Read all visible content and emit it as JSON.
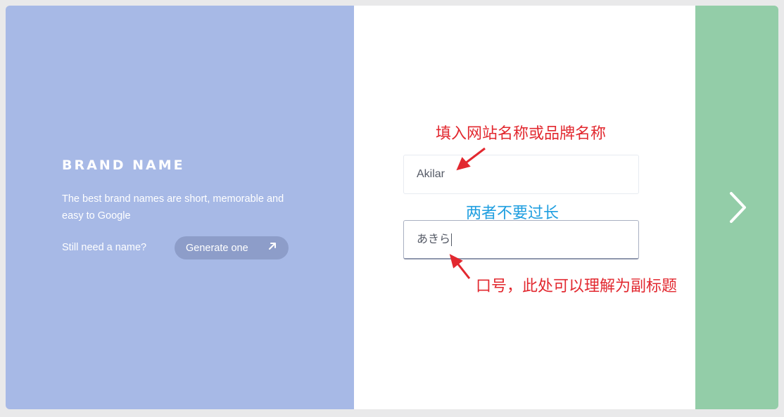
{
  "left": {
    "title": "BRAND NAME",
    "description": "The best brand names are short, memorable and easy to Google",
    "prompt": "Still need a name?",
    "generate_label": "Generate one",
    "arrow_icon": "arrow-up-right-icon"
  },
  "form": {
    "name_value": "Akilar",
    "slogan_value": "あきら"
  },
  "nav": {
    "next_icon": "chevron-right-icon"
  },
  "annotations": {
    "name_note": "填入网站名称或品牌名称",
    "length_note": "两者不要过长",
    "slogan_note": "口号，此处可以理解为副标题"
  },
  "colors": {
    "left_panel": "#a7b9e6",
    "right_panel": "#93cda8",
    "annotation_red": "#e2282f",
    "annotation_blue": "#1e9ee0"
  }
}
